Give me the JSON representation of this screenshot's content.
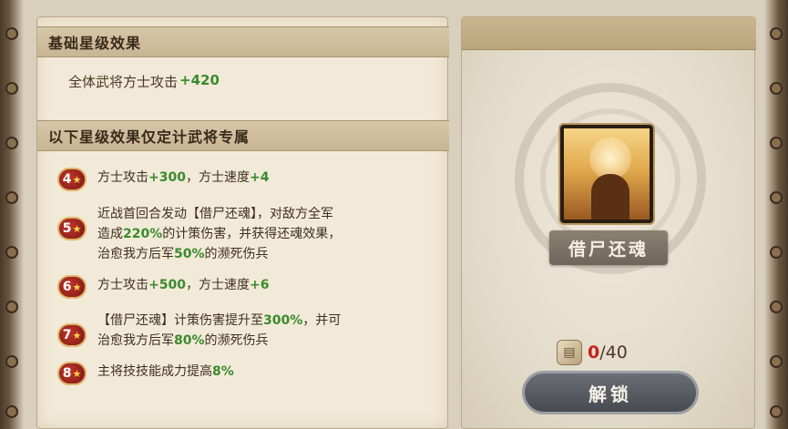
{
  "base": {
    "header": "基础星级效果",
    "effect_prefix": "全体武将方士攻击",
    "effect_value": "+420"
  },
  "exclusive": {
    "header": "以下星级效果仅定计武将专属",
    "rows": [
      {
        "level": "4",
        "parts": [
          "方士攻击",
          "+300",
          "，方士速度",
          "+4"
        ]
      },
      {
        "level": "5",
        "line1": "近战首回合发动【借尸还魂】，对敌方全军",
        "line2_a": "造成",
        "line2_b": "220%",
        "line2_c": "的计策伤害，并获得还魂效果，",
        "line3_a": "治愈我方后军",
        "line3_b": "50%",
        "line3_c": "的濒死伤兵"
      },
      {
        "level": "6",
        "parts": [
          "方士攻击",
          "+500",
          "，方士速度",
          "+6"
        ]
      },
      {
        "level": "7",
        "line1_a": "【借尸还魂】计策伤害提升至",
        "line1_b": "300%",
        "line1_c": "，并可",
        "line2_a": "治愈我方后军",
        "line2_b": "80%",
        "line2_c": "的濒死伤兵"
      },
      {
        "level": "8",
        "parts": [
          "主将技技能成力提高",
          "8%"
        ]
      }
    ]
  },
  "skill": {
    "name": "借尸还魂",
    "icon": "skill-portrait-icon"
  },
  "cost": {
    "icon": "scroll-icon",
    "current": "0",
    "total": "/40"
  },
  "unlock_label": "解锁",
  "colors": {
    "highlight_green": "#3a8a2e",
    "cost_red": "#c0251c",
    "badge_red": "#a8261d"
  }
}
